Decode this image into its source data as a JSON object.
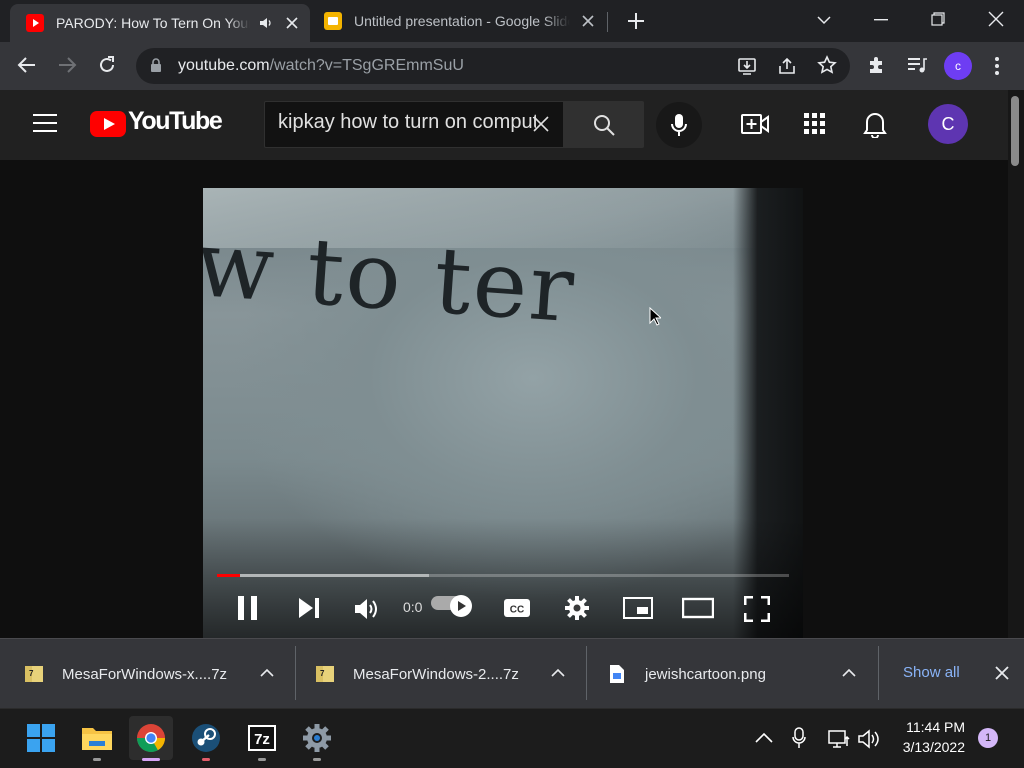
{
  "browser": {
    "tabs": [
      {
        "title": "PARODY: How To Tern On Your Computer",
        "favicon": "youtube-icon",
        "state": "active",
        "audio": true
      },
      {
        "title": "Untitled presentation - Google Slides",
        "favicon": "google-slides-icon",
        "state": "inactive"
      }
    ],
    "address": {
      "host": "youtube.com",
      "path": "/watch?v=TSgGREmmSuU"
    },
    "profile_initial": "c"
  },
  "youtube": {
    "logo_text": "YouTube",
    "search_query": "kipkay how to turn on computer",
    "avatar_initial": "C",
    "brand_color": "#ff0000"
  },
  "video": {
    "overlay_text": "w to ter",
    "time_display": "0:0",
    "progress_played_fraction": 0.04,
    "progress_loaded_fraction": 0.37
  },
  "downloads": {
    "items": [
      {
        "name": "MesaForWindows-x....7z",
        "icon": "7z-archive-icon"
      },
      {
        "name": "MesaForWindows-2....7z",
        "icon": "7z-archive-icon"
      },
      {
        "name": "jewishcartoon.png",
        "icon": "image-file-icon"
      }
    ],
    "show_all": "Show all"
  },
  "taskbar": {
    "apps": [
      "windows-start-icon",
      "file-explorer-icon",
      "chrome-icon",
      "steam-icon",
      "7zip-icon",
      "settings-gear-icon"
    ],
    "time": "11:44 PM",
    "date": "3/13/2022",
    "notification_count": "1"
  }
}
